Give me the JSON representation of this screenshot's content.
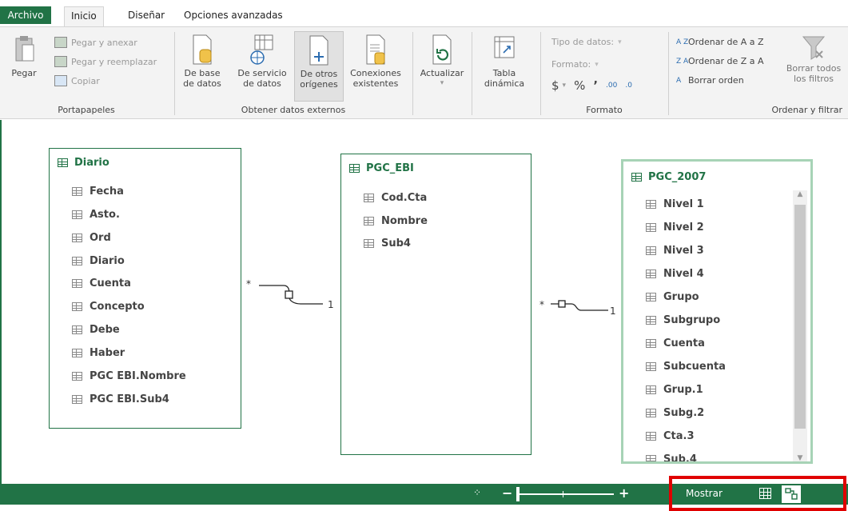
{
  "tabs": [
    "Archivo",
    "Inicio",
    "Diseñar",
    "Opciones avanzadas"
  ],
  "clipboard": {
    "paste": "Pegar",
    "paste_append": "Pegar y anexar",
    "paste_replace": "Pegar y reemplazar",
    "copy": "Copiar",
    "group": "Portapapeles"
  },
  "external": {
    "db_l1": "De base",
    "db_l2": "de datos",
    "svc_l1": "De servicio",
    "svc_l2": "de datos",
    "other_l1": "De otros",
    "other_l2": "orígenes",
    "conn_l1": "Conexiones",
    "conn_l2": "existentes",
    "group": "Obtener datos externos"
  },
  "refresh": {
    "label": "Actualizar"
  },
  "pivot": {
    "l1": "Tabla",
    "l2": "dinámica"
  },
  "format": {
    "datatype": "Tipo de datos:",
    "format": "Formato:",
    "currency": "$",
    "percent": "%",
    "comma": "’",
    "inc": ".00",
    "dec": ".0",
    "group": "Formato"
  },
  "sort": {
    "az": "Ordenar de A a Z",
    "za": "Ordenar de Z a A",
    "clear": "Borrar orden",
    "clear_all_l1": "Borrar todos",
    "clear_all_l2": "los filtros",
    "group": "Ordenar y filtrar"
  },
  "tables": {
    "diario": {
      "name": "Diario",
      "fields": [
        "Fecha",
        "Asto.",
        "Ord",
        "Diario",
        "Cuenta",
        "Concepto",
        "Debe",
        "Haber",
        "PGC EBI.Nombre",
        "PGC EBI.Sub4"
      ]
    },
    "pgc_ebi": {
      "name": "PGC_EBI",
      "fields": [
        "Cod.Cta",
        "Nombre",
        "Sub4"
      ]
    },
    "pgc_2007": {
      "name": "PGC_2007",
      "fields": [
        "Nivel 1",
        "Nivel 2",
        "Nivel 3",
        "Nivel 4",
        "Grupo",
        "Subgrupo",
        "Cuenta",
        "Subcuenta",
        "Grup.1",
        "Subg.2",
        "Cta.3",
        "Sub.4"
      ]
    }
  },
  "relations": {
    "many": "*",
    "one": "1"
  },
  "status": {
    "show": "Mostrar",
    "zoom_minus": "−",
    "zoom_plus": "+"
  },
  "colors": {
    "accent": "#217346",
    "highlight": "#e00000"
  }
}
